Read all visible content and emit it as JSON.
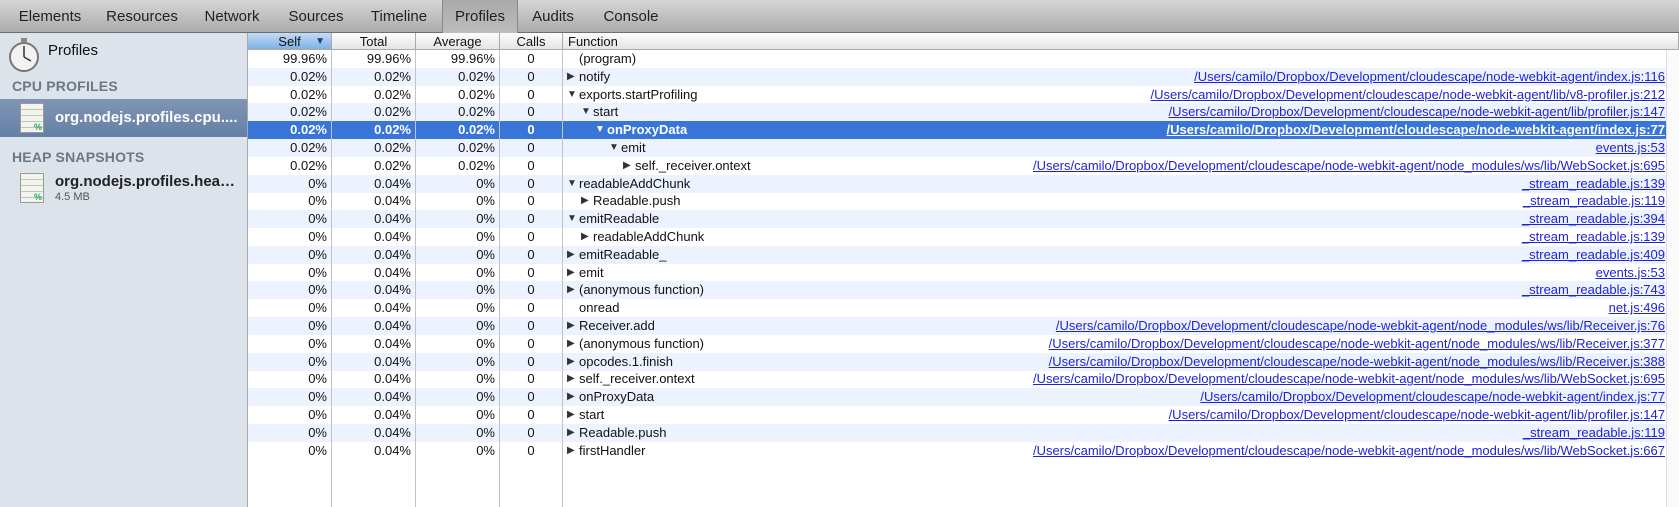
{
  "toolbar": {
    "tabs": [
      {
        "label": "Elements"
      },
      {
        "label": "Resources"
      },
      {
        "label": "Network"
      },
      {
        "label": "Sources"
      },
      {
        "label": "Timeline"
      },
      {
        "label": "Profiles"
      },
      {
        "label": "Audits"
      },
      {
        "label": "Console"
      }
    ],
    "active_tab": "Profiles"
  },
  "sidebar": {
    "title": "Profiles",
    "cpu_heading": "CPU PROFILES",
    "cpu_item": "org.nodejs.profiles.cpu....",
    "heap_heading": "HEAP SNAPSHOTS",
    "heap_item": "org.nodejs.profiles.heap....",
    "heap_size": "4.5 MB",
    "icon_badge": "%"
  },
  "grid": {
    "headers": {
      "self": "Self",
      "total": "Total",
      "average": "Average",
      "calls": "Calls",
      "function": "Function"
    },
    "rows": [
      {
        "self": "99.96%",
        "total": "99.96%",
        "avg": "99.96%",
        "calls": "0",
        "fn": "(program)",
        "indent": 0,
        "toggle": "",
        "url": ""
      },
      {
        "self": "0.02%",
        "total": "0.02%",
        "avg": "0.02%",
        "calls": "0",
        "fn": "notify",
        "indent": 0,
        "toggle": "▶",
        "url": "/Users/camilo/Dropbox/Development/cloudescape/node-webkit-agent/index.js:116"
      },
      {
        "self": "0.02%",
        "total": "0.02%",
        "avg": "0.02%",
        "calls": "0",
        "fn": "exports.startProfiling",
        "indent": 0,
        "toggle": "▼",
        "url": "/Users/camilo/Dropbox/Development/cloudescape/node-webkit-agent/lib/v8-profiler.js:212"
      },
      {
        "self": "0.02%",
        "total": "0.02%",
        "avg": "0.02%",
        "calls": "0",
        "fn": "start",
        "indent": 1,
        "toggle": "▼",
        "url": "/Users/camilo/Dropbox/Development/cloudescape/node-webkit-agent/lib/profiler.js:147"
      },
      {
        "self": "0.02%",
        "total": "0.02%",
        "avg": "0.02%",
        "calls": "0",
        "fn": "onProxyData",
        "indent": 2,
        "toggle": "▼",
        "url": "/Users/camilo/Dropbox/Development/cloudescape/node-webkit-agent/index.js:77",
        "selected": true
      },
      {
        "self": "0.02%",
        "total": "0.02%",
        "avg": "0.02%",
        "calls": "0",
        "fn": "emit",
        "indent": 3,
        "toggle": "▼",
        "url": "events.js:53"
      },
      {
        "self": "0.02%",
        "total": "0.02%",
        "avg": "0.02%",
        "calls": "0",
        "fn": "self._receiver.ontext",
        "indent": 4,
        "toggle": "▶",
        "url": "/Users/camilo/Dropbox/Development/cloudescape/node-webkit-agent/node_modules/ws/lib/WebSocket.js:695"
      },
      {
        "self": "0%",
        "total": "0.04%",
        "avg": "0%",
        "calls": "0",
        "fn": "readableAddChunk",
        "indent": 0,
        "toggle": "▼",
        "url": "_stream_readable.js:139"
      },
      {
        "self": "0%",
        "total": "0.04%",
        "avg": "0%",
        "calls": "0",
        "fn": "Readable.push",
        "indent": 1,
        "toggle": "▶",
        "url": "_stream_readable.js:119"
      },
      {
        "self": "0%",
        "total": "0.04%",
        "avg": "0%",
        "calls": "0",
        "fn": "emitReadable",
        "indent": 0,
        "toggle": "▼",
        "url": "_stream_readable.js:394"
      },
      {
        "self": "0%",
        "total": "0.04%",
        "avg": "0%",
        "calls": "0",
        "fn": "readableAddChunk",
        "indent": 1,
        "toggle": "▶",
        "url": "_stream_readable.js:139"
      },
      {
        "self": "0%",
        "total": "0.04%",
        "avg": "0%",
        "calls": "0",
        "fn": "emitReadable_",
        "indent": 0,
        "toggle": "▶",
        "url": "_stream_readable.js:409"
      },
      {
        "self": "0%",
        "total": "0.04%",
        "avg": "0%",
        "calls": "0",
        "fn": "emit",
        "indent": 0,
        "toggle": "▶",
        "url": "events.js:53"
      },
      {
        "self": "0%",
        "total": "0.04%",
        "avg": "0%",
        "calls": "0",
        "fn": "(anonymous function)",
        "indent": 0,
        "toggle": "▶",
        "url": "_stream_readable.js:743"
      },
      {
        "self": "0%",
        "total": "0.04%",
        "avg": "0%",
        "calls": "0",
        "fn": "onread",
        "indent": 0,
        "toggle": "",
        "url": "net.js:496"
      },
      {
        "self": "0%",
        "total": "0.04%",
        "avg": "0%",
        "calls": "0",
        "fn": "Receiver.add",
        "indent": 0,
        "toggle": "▶",
        "url": "/Users/camilo/Dropbox/Development/cloudescape/node-webkit-agent/node_modules/ws/lib/Receiver.js:76"
      },
      {
        "self": "0%",
        "total": "0.04%",
        "avg": "0%",
        "calls": "0",
        "fn": "(anonymous function)",
        "indent": 0,
        "toggle": "▶",
        "url": "/Users/camilo/Dropbox/Development/cloudescape/node-webkit-agent/node_modules/ws/lib/Receiver.js:377"
      },
      {
        "self": "0%",
        "total": "0.04%",
        "avg": "0%",
        "calls": "0",
        "fn": "opcodes.1.finish",
        "indent": 0,
        "toggle": "▶",
        "url": "/Users/camilo/Dropbox/Development/cloudescape/node-webkit-agent/node_modules/ws/lib/Receiver.js:388"
      },
      {
        "self": "0%",
        "total": "0.04%",
        "avg": "0%",
        "calls": "0",
        "fn": "self._receiver.ontext",
        "indent": 0,
        "toggle": "▶",
        "url": "/Users/camilo/Dropbox/Development/cloudescape/node-webkit-agent/node_modules/ws/lib/WebSocket.js:695"
      },
      {
        "self": "0%",
        "total": "0.04%",
        "avg": "0%",
        "calls": "0",
        "fn": "onProxyData",
        "indent": 0,
        "toggle": "▶",
        "url": "/Users/camilo/Dropbox/Development/cloudescape/node-webkit-agent/index.js:77"
      },
      {
        "self": "0%",
        "total": "0.04%",
        "avg": "0%",
        "calls": "0",
        "fn": "start",
        "indent": 0,
        "toggle": "▶",
        "url": "/Users/camilo/Dropbox/Development/cloudescape/node-webkit-agent/lib/profiler.js:147"
      },
      {
        "self": "0%",
        "total": "0.04%",
        "avg": "0%",
        "calls": "0",
        "fn": "Readable.push",
        "indent": 0,
        "toggle": "▶",
        "url": "_stream_readable.js:119"
      },
      {
        "self": "0%",
        "total": "0.04%",
        "avg": "0%",
        "calls": "0",
        "fn": "firstHandler",
        "indent": 0,
        "toggle": "▶",
        "url": "/Users/camilo/Dropbox/Development/cloudescape/node-webkit-agent/node_modules/ws/lib/WebSocket.js:667"
      }
    ]
  }
}
